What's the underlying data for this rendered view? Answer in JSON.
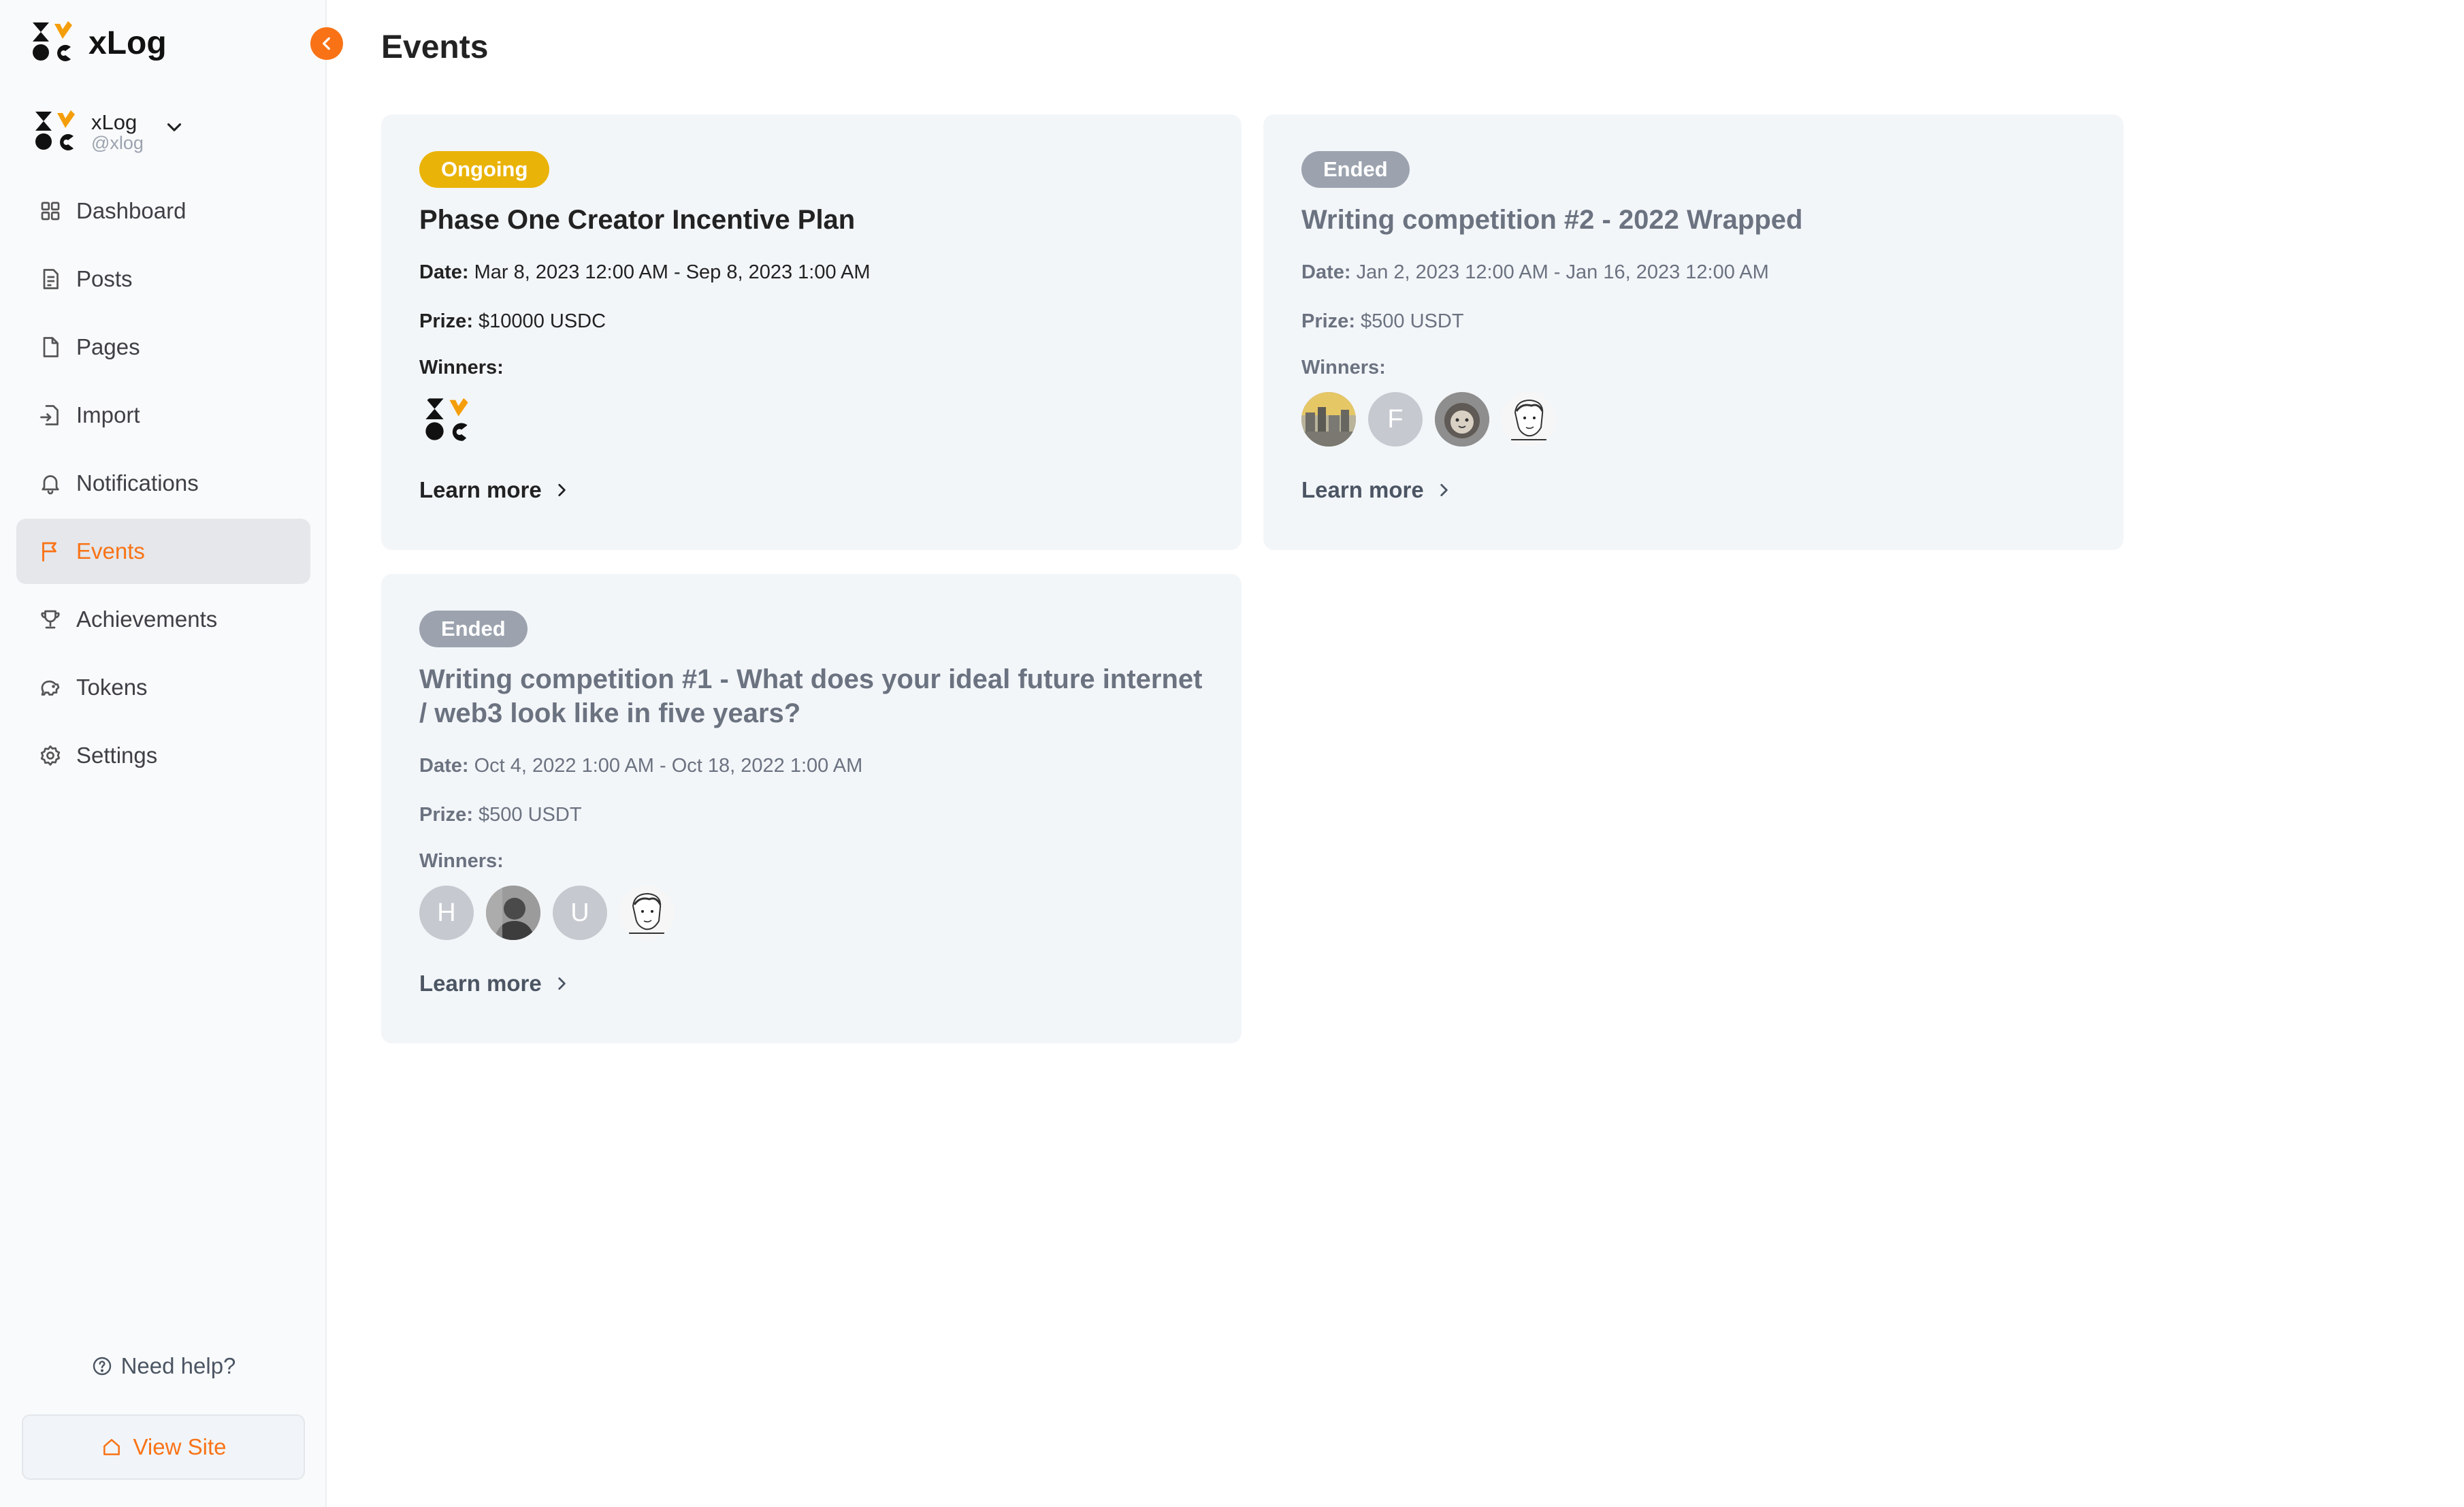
{
  "app": {
    "name": "xLog"
  },
  "site": {
    "name": "xLog",
    "handle": "@xlog"
  },
  "nav": [
    {
      "label": "Dashboard",
      "icon": "dashboard-icon"
    },
    {
      "label": "Posts",
      "icon": "posts-icon"
    },
    {
      "label": "Pages",
      "icon": "pages-icon"
    },
    {
      "label": "Import",
      "icon": "import-icon"
    },
    {
      "label": "Notifications",
      "icon": "bell-icon"
    },
    {
      "label": "Events",
      "icon": "flag-icon",
      "active": true
    },
    {
      "label": "Achievements",
      "icon": "trophy-icon"
    },
    {
      "label": "Tokens",
      "icon": "piggy-bank-icon"
    },
    {
      "label": "Settings",
      "icon": "gear-icon"
    }
  ],
  "help": "Need help?",
  "view_site": "View Site",
  "page": {
    "title": "Events"
  },
  "labels": {
    "date": "Date:",
    "prize": "Prize:",
    "winners": "Winners:",
    "learn_more": "Learn more"
  },
  "events": [
    {
      "status": "Ongoing",
      "title": "Phase One Creator Incentive Plan",
      "date": "Mar 8, 2023 12:00 AM - Sep 8, 2023 1:00 AM",
      "prize": "$10000 USDC",
      "winners": [
        "xlog-logo"
      ]
    },
    {
      "status": "Ended",
      "title": "Writing competition #2 - 2022 Wrapped",
      "date": "Jan 2, 2023 12:00 AM - Jan 16, 2023 12:00 AM",
      "prize": "$500 USDT",
      "winners": [
        "photo",
        "F",
        "lion",
        "sketch"
      ]
    },
    {
      "status": "Ended",
      "title": "Writing competition #1 - What does your ideal future internet / web3 look like in five years?",
      "date": "Oct 4, 2022 1:00 AM - Oct 18, 2022 1:00 AM",
      "prize": "$500 USDT",
      "winners": [
        "H",
        "photo",
        "U",
        "sketch"
      ]
    }
  ],
  "colors": {
    "accent": "#f97316",
    "ongoing": "#eab308",
    "ended": "#9ca3af",
    "card": "#f3f6f9"
  }
}
